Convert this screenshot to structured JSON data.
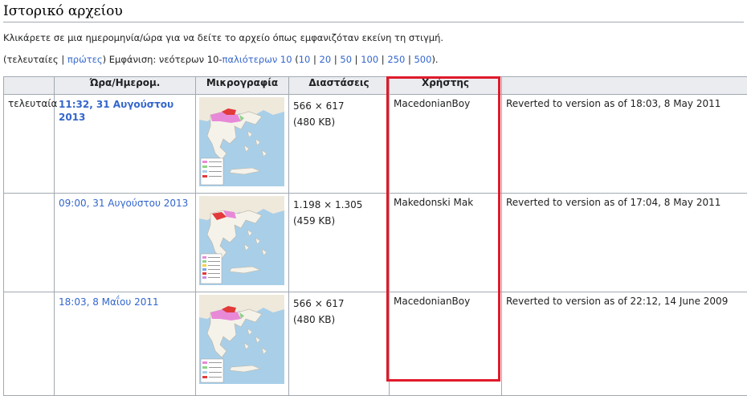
{
  "heading": "Ιστορικό αρχείου",
  "intro": "Κλικάρετε σε μια ημερομηνία/ώρα για να δείτε το αρχείο όπως εμφανιζόταν εκείνη τη στιγμή.",
  "nav": {
    "open": "(τελευταίες | ",
    "first_link": "πρώτες",
    "mid": ") Εμφάνιση: νεότερων 10-",
    "older_link": "παλιότερων 10",
    "counts_open": " (",
    "counts": [
      "10",
      "20",
      "50",
      "100",
      "250",
      "500"
    ],
    "sep": " | ",
    "counts_close": ")."
  },
  "table": {
    "headers": [
      "",
      "Ώρα/Ημερομ.",
      "Μικρογραφία",
      "Διαστάσεις",
      "Χρήστης",
      ""
    ],
    "rows": [
      {
        "label": "τελευταία",
        "date": "11:32, 31 Αυγούστου 2013",
        "dims": "566 × 617",
        "size": "(480 KB)",
        "user": "MacedonianBoy",
        "comment": "Reverted to version as of 18:03, 8 May 2011"
      },
      {
        "label": "",
        "date": "09:00, 31 Αυγούστου 2013",
        "dims": "1.198 × 1.305",
        "size": "(459 KB)",
        "user": "Makedonski Mak",
        "comment": "Reverted to version as of 17:04, 8 May 2011"
      },
      {
        "label": "",
        "date": "18:03, 8 Μαΐου 2011",
        "dims": "566 × 617",
        "size": "(480 KB)",
        "user": "MacedonianBoy",
        "comment": "Reverted to version as of 22:12, 14 June 2009"
      }
    ]
  },
  "colors": {
    "link": "#3366cc",
    "header_bg": "#eaecf0",
    "border": "#a2a9b1",
    "highlight": "#e01a2b",
    "sea": "#a9cfe8",
    "land": "#f5f2ea"
  },
  "icons": [
    "map-thumbnail-icon"
  ]
}
